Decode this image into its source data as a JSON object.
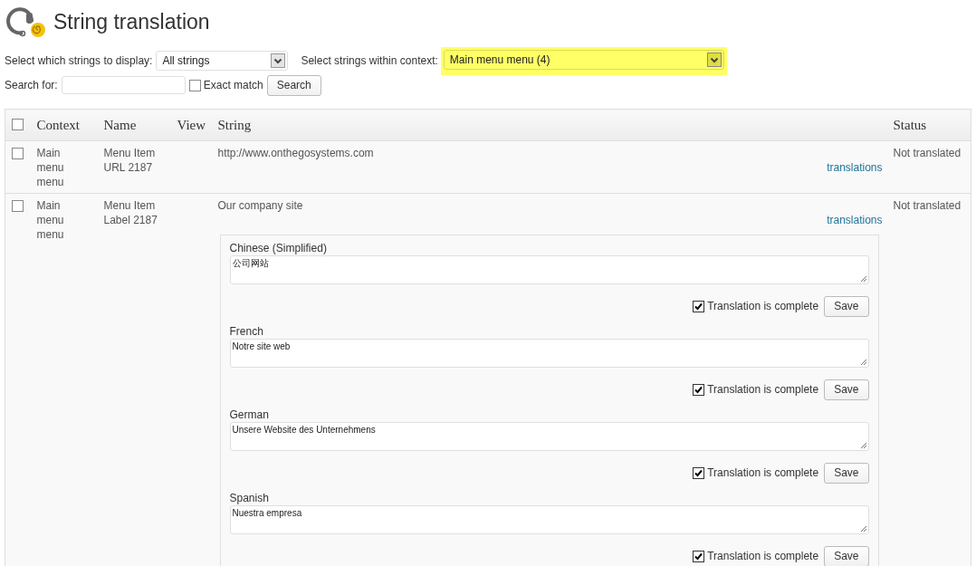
{
  "title": "String translation",
  "filters": {
    "display": {
      "label": "Select which strings to display:",
      "value": "All strings"
    },
    "context": {
      "label": "Select strings within context:",
      "value": "Main menu menu (4)",
      "highlighted": true
    }
  },
  "search": {
    "label": "Search for:",
    "exact_match": {
      "label": "Exact match",
      "checked": false
    },
    "button": "Search"
  },
  "table": {
    "select_all": {
      "checked": false
    },
    "columns": [
      "Context",
      "Name",
      "View",
      "String",
      "Status"
    ],
    "rows": [
      {
        "checked": false,
        "context": "Main menu menu",
        "name": "Menu Item URL 2187",
        "string": "http://www.onthegosystems.com",
        "link": "translations",
        "status": "Not translated"
      },
      {
        "checked": false,
        "context": "Main menu menu",
        "name": "Menu Item Label 2187",
        "string": "Our company site",
        "link": "translations",
        "status": "Not translated",
        "translations": [
          {
            "language": "Chinese (Simplified)",
            "value": "公司网站",
            "complete": true,
            "complete_label": "Translation is complete",
            "save": "Save"
          },
          {
            "language": "French",
            "value": "Notre site web",
            "complete": true,
            "complete_label": "Translation is complete",
            "save": "Save"
          },
          {
            "language": "German",
            "value": "Unsere Website des Unternehmens",
            "complete": true,
            "complete_label": "Translation is complete",
            "save": "Save"
          },
          {
            "language": "Spanish",
            "value": "Nuestra empresa",
            "complete": true,
            "complete_label": "Translation is complete",
            "save": "Save"
          }
        ]
      }
    ]
  }
}
